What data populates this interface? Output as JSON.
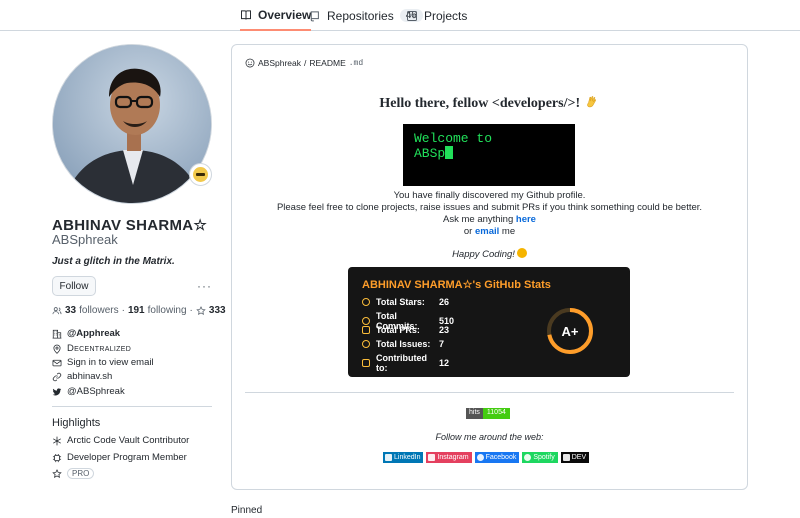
{
  "nav": {
    "tabs": [
      {
        "label": "Overview",
        "icon": "book-icon",
        "active": true
      },
      {
        "label": "Repositories",
        "icon": "repo-icon",
        "count": "46"
      },
      {
        "label": "Projects",
        "icon": "project-icon"
      }
    ]
  },
  "profile": {
    "fullname": "ABHINAV SHARMA☆",
    "username": "ABSphreak",
    "bio": "Just a glitch in the Matrix.",
    "follow_label": "Follow",
    "more_label": "···",
    "followers_count": "33",
    "followers_label": "followers",
    "following_count": "191",
    "following_label": "following",
    "stars_count": "333",
    "company": "@Apphreak",
    "location": "Decentralized",
    "email": "Sign in to view email",
    "website": "abhinav.sh",
    "twitter": "@ABSphreak"
  },
  "highlights": {
    "title": "Highlights",
    "items": [
      "Arctic Code Vault Contributor",
      "Developer Program Member"
    ],
    "pro_label": "PRO"
  },
  "readme": {
    "path_user": "ABSphreak",
    "path_sep": "/",
    "path_file": "README",
    "path_ext": ".md",
    "heading_pre": "Hello there, fellow ",
    "heading_code": "<developers/>",
    "heading_post": "!",
    "terminal_line1": "Welcome to",
    "terminal_line2": "ABSp",
    "line1": "You have finally discovered my Github profile.",
    "line2": "Please feel free to clone projects, raise issues and submit PRs if you think something could be better.",
    "line3_pre": "Ask me anything ",
    "line3_link": "here",
    "line4_pre": "or ",
    "line4_link": "email",
    "line4_post": " me",
    "happy": "Happy Coding!",
    "follow_line": "Follow me around the web:"
  },
  "stats_card": {
    "title": "ABHINAV SHARMA☆'s GitHub Stats",
    "rows": [
      {
        "label": "Total Stars:",
        "value": "26"
      },
      {
        "label": "Total Commits:",
        "value": "510"
      },
      {
        "label": "Total PRs:",
        "value": "23"
      },
      {
        "label": "Total Issues:",
        "value": "7"
      },
      {
        "label": "Contributed to:",
        "value": "12"
      }
    ],
    "grade": "A+",
    "accent": "#fe9d2a",
    "icon_color": "#fbbd3a"
  },
  "hits": {
    "label": "hits",
    "value": "11054"
  },
  "socials": [
    {
      "label": "LinkedIn",
      "color": "#0077b5",
      "icon": "linkedin-icon"
    },
    {
      "label": "Instagram",
      "color": "#e4405f",
      "icon": "instagram-icon"
    },
    {
      "label": "Facebook",
      "color": "#1877f2",
      "icon": "facebook-icon"
    },
    {
      "label": "Spotify",
      "color": "#1ed760",
      "icon": "spotify-icon"
    },
    {
      "label": "DEV",
      "color": "#0a0a0a",
      "icon": "dev-icon"
    }
  ],
  "pinned_label": "Pinned"
}
